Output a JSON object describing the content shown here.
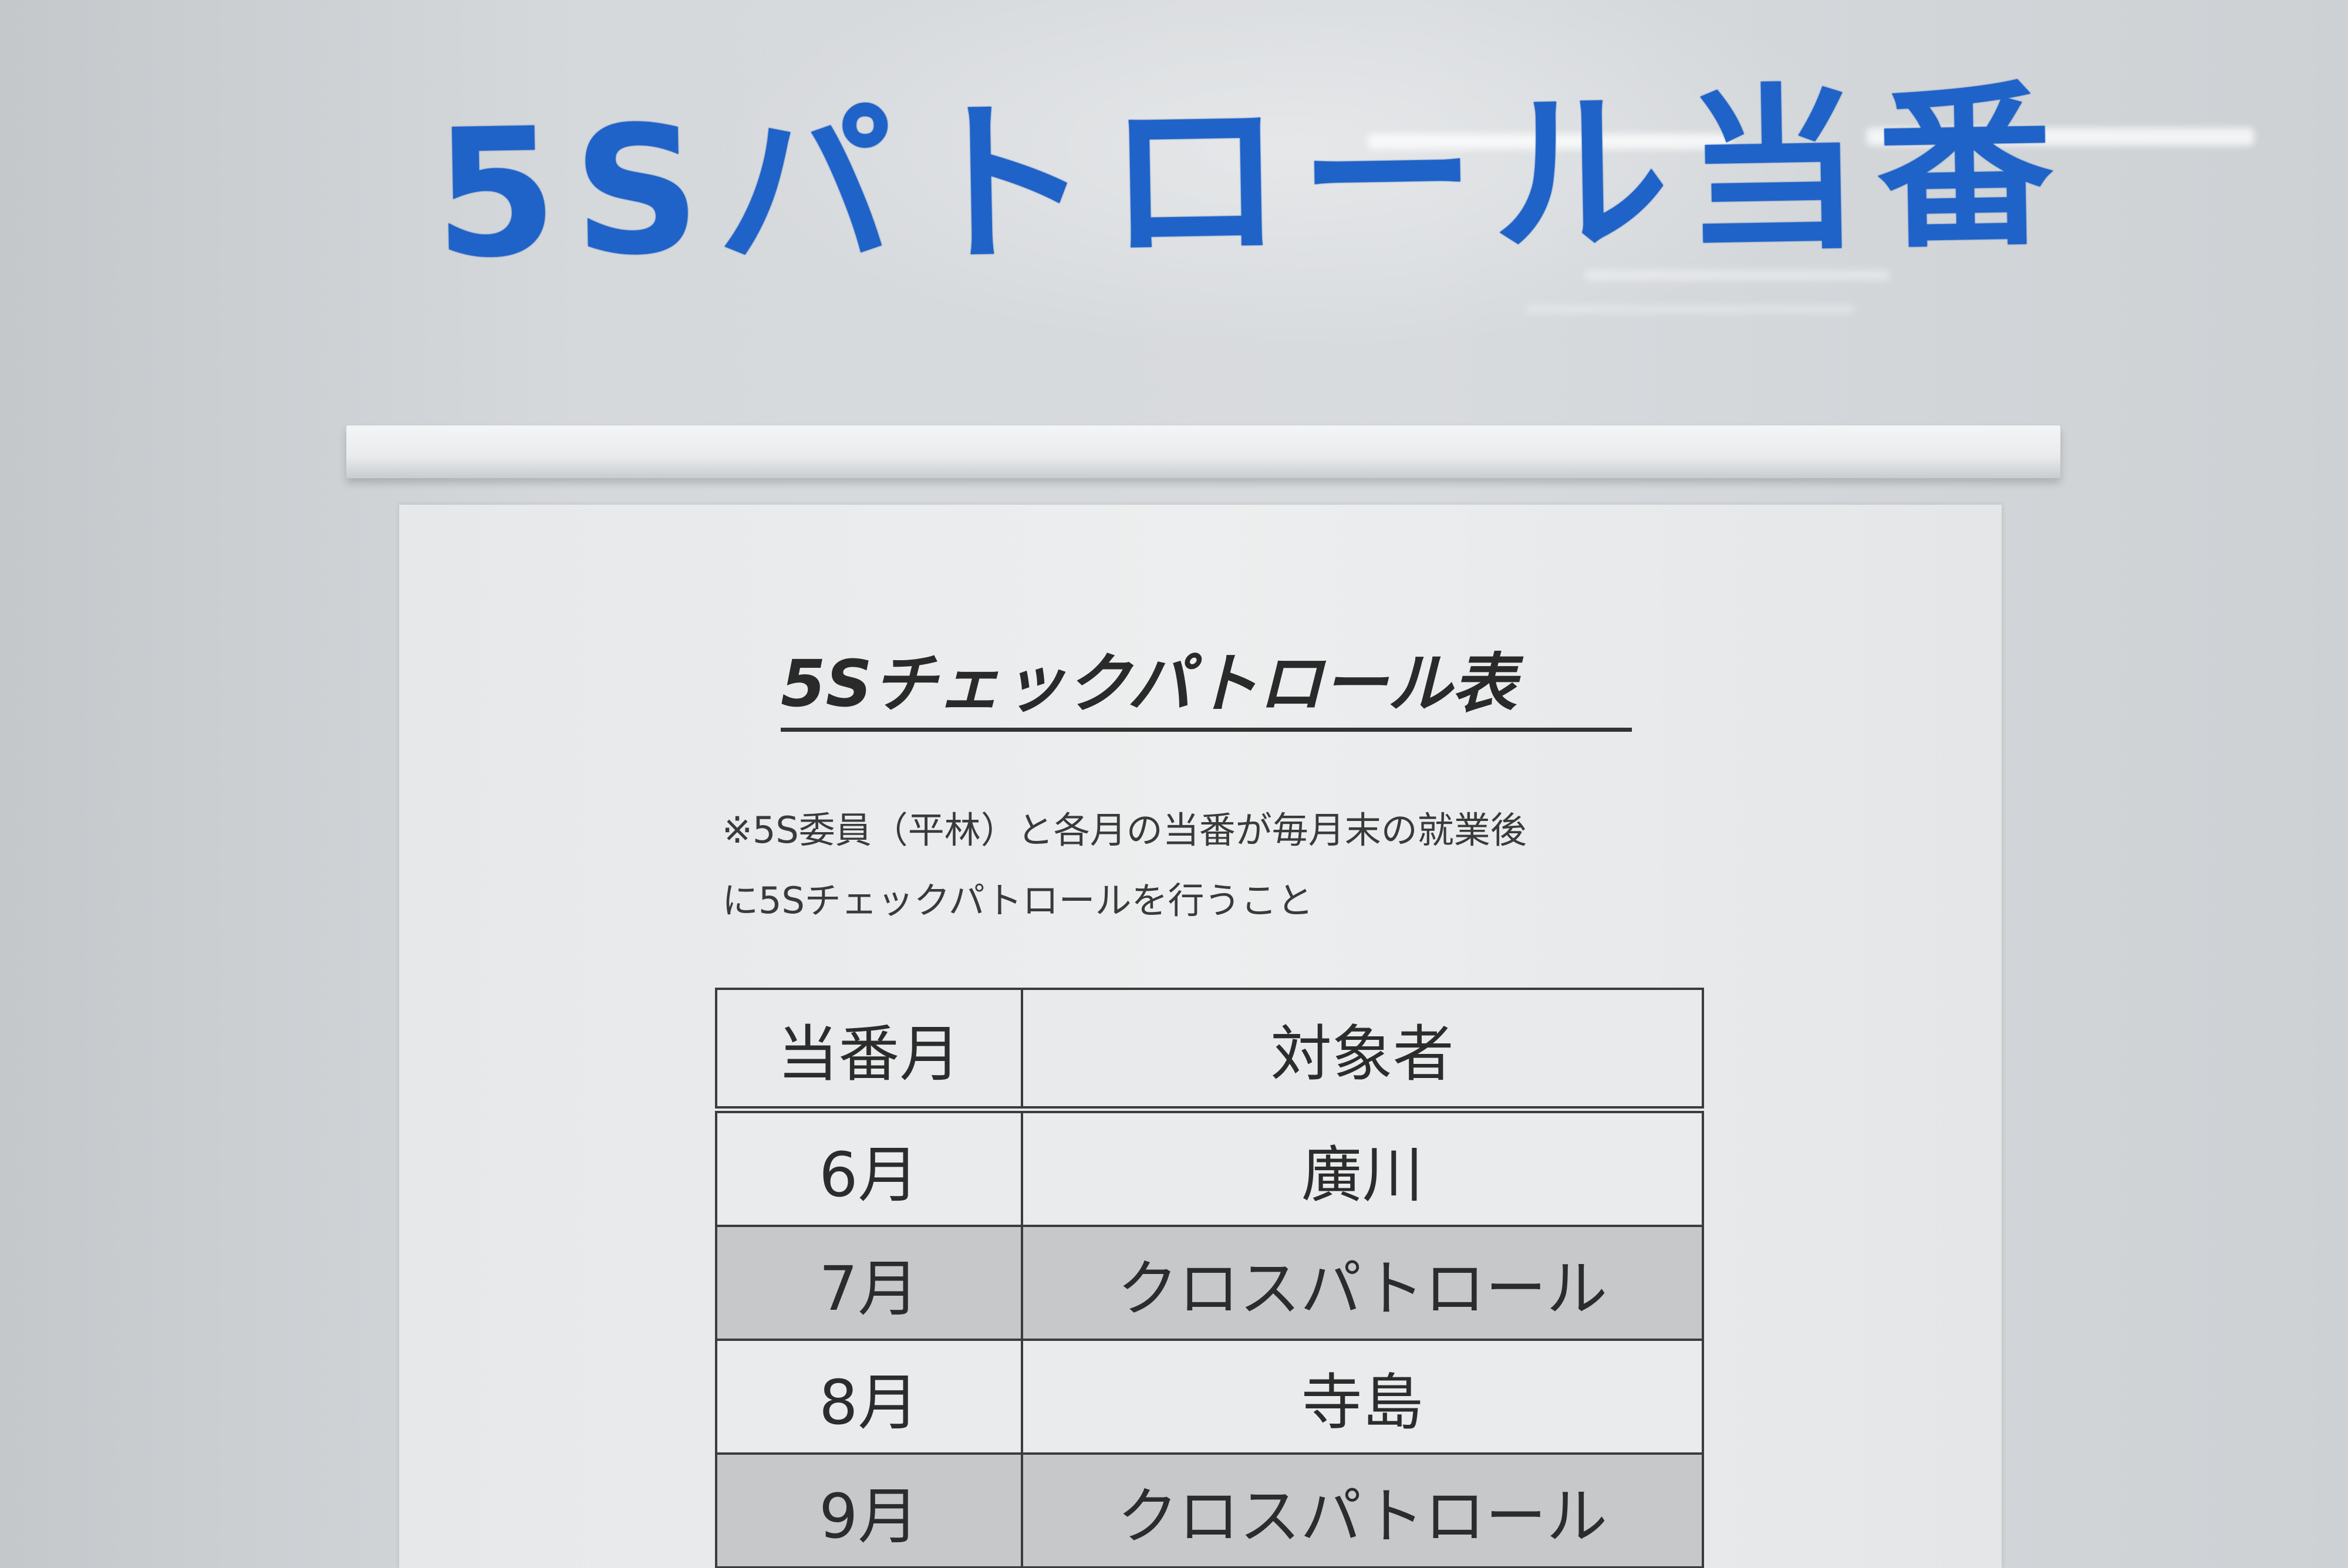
{
  "whiteboard": {
    "handwritten_title": "5Sパトロール当番"
  },
  "poster": {
    "title": "5Sチェックパトロール表",
    "note_line_1": "※5S委員（平林）と各月の当番が毎月末の就業後",
    "note_line_2": "に5Sチェックパトロールを行うこと",
    "table": {
      "headers": [
        "当番月",
        "対象者"
      ],
      "rows": [
        {
          "month": "6月",
          "person": "廣川",
          "shaded": false
        },
        {
          "month": "7月",
          "person": "クロスパトロール",
          "shaded": true
        },
        {
          "month": "8月",
          "person": "寺島",
          "shaded": false
        },
        {
          "month": "9月",
          "person": "クロスパトロール",
          "shaded": true
        }
      ]
    }
  },
  "colors": {
    "marker_blue": "#1f63c8",
    "board": "#d6d9dc",
    "paper": "#eceeef",
    "shaded_row": "#c6c8ca"
  }
}
